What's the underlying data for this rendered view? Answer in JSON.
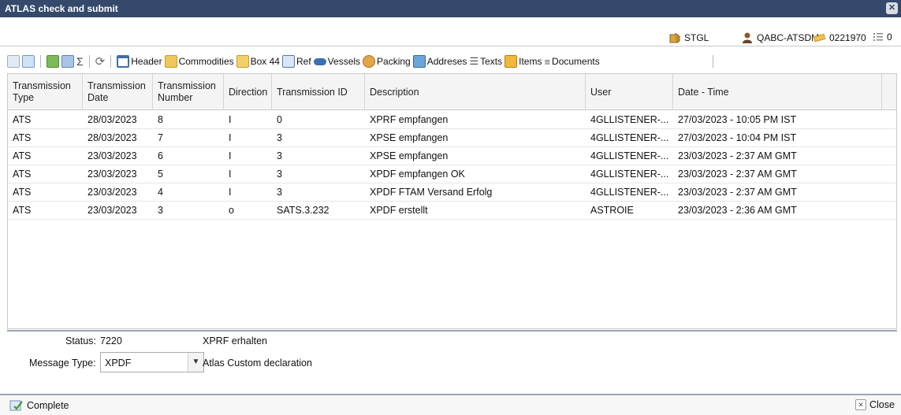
{
  "window": {
    "title": "ATLAS check and submit",
    "close_symbol": "✕"
  },
  "infobar": {
    "location": "STGL",
    "user": "QABC-ATSDM",
    "reference": "0221970",
    "count": "0"
  },
  "toolbar": {
    "header": "Header",
    "commodities": "Commodities",
    "box44": "Box 44",
    "ref": "Ref",
    "vessels": "Vessels",
    "packing": "Packing",
    "addresses": "Addreses",
    "texts": "Texts",
    "items": "Items",
    "documents": "Documents",
    "sum_symbol": "Σ"
  },
  "table": {
    "columns": {
      "type": "Transmission Type",
      "date": "Transmission Date",
      "number": "Transmission Number",
      "direction": "Direction",
      "id": "Transmission ID",
      "description": "Description",
      "user": "User",
      "datetime": "Date - Time"
    },
    "rows": [
      {
        "type": "ATS",
        "date": "28/03/2023",
        "number": "8",
        "direction": "I",
        "id": "0",
        "description": "XPRF empfangen",
        "user": "4GLLISTENER-...",
        "datetime": "27/03/2023 - 10:05 PM IST"
      },
      {
        "type": "ATS",
        "date": "28/03/2023",
        "number": "7",
        "direction": "I",
        "id": "3",
        "description": "XPSE empfangen",
        "user": "4GLLISTENER-...",
        "datetime": "27/03/2023 - 10:04 PM IST"
      },
      {
        "type": "ATS",
        "date": "23/03/2023",
        "number": "6",
        "direction": "I",
        "id": "3",
        "description": "XPSE empfangen",
        "user": "4GLLISTENER-...",
        "datetime": "23/03/2023 - 2:37 AM GMT"
      },
      {
        "type": "ATS",
        "date": "23/03/2023",
        "number": "5",
        "direction": "I",
        "id": "3",
        "description": "XPDF empfangen OK",
        "user": "4GLLISTENER-...",
        "datetime": "23/03/2023 - 2:37 AM GMT"
      },
      {
        "type": "ATS",
        "date": "23/03/2023",
        "number": "4",
        "direction": "I",
        "id": "3",
        "description": "XPDF FTAM Versand Erfolg",
        "user": "4GLLISTENER-...",
        "datetime": "23/03/2023 - 2:37 AM GMT"
      },
      {
        "type": "ATS",
        "date": "23/03/2023",
        "number": "3",
        "direction": "o",
        "id": "SATS.3.232",
        "description": "XPDF erstellt",
        "user": "ASTROIE",
        "datetime": "23/03/2023 - 2:36 AM GMT"
      }
    ]
  },
  "status": {
    "status_label": "Status:",
    "status_code": "7220",
    "status_text": "XPRF erhalten",
    "message_type_label": "Message Type:",
    "message_type_value": "XPDF",
    "message_type_desc": "Atlas Custom declaration"
  },
  "footer": {
    "complete": "Complete",
    "close": "Close",
    "close_symbol": "✕"
  }
}
